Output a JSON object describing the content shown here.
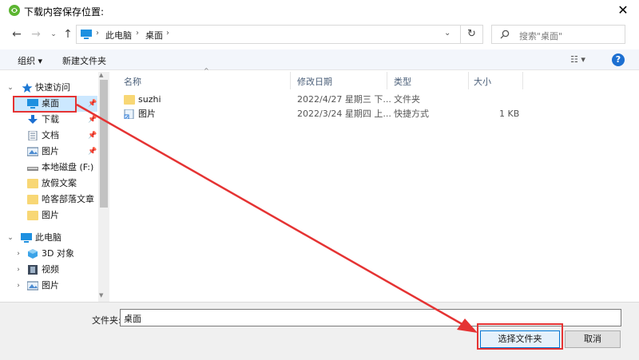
{
  "window": {
    "title": "下载内容保存位置:",
    "close_glyph": "✕"
  },
  "nav": {
    "back": "←",
    "forward": "→",
    "recent": "⌄",
    "up": "↑",
    "breadcrumb": [
      "此电脑",
      "桌面"
    ],
    "separator": "›",
    "dropdown": "⌄",
    "refresh": "↻",
    "search_placeholder": "搜索\"桌面\""
  },
  "toolbar": {
    "organize": "组织 ▾",
    "new_folder": "新建文件夹",
    "view": "☷ ▾",
    "help": "?"
  },
  "sidebar": {
    "items": [
      {
        "label": "快速访问",
        "icon": "star-icon",
        "expand": "⌄"
      },
      {
        "label": "桌面",
        "icon": "desktop-icon",
        "pin": "📌"
      },
      {
        "label": "下载",
        "icon": "download-icon",
        "pin": "📌"
      },
      {
        "label": "文档",
        "icon": "document-icon",
        "pin": "📌"
      },
      {
        "label": "图片",
        "icon": "pictures-icon",
        "pin": "📌"
      },
      {
        "label": "本地磁盘 (F:)",
        "icon": "drive-icon"
      },
      {
        "label": "放假文案",
        "icon": "folder-icon"
      },
      {
        "label": "哈客部落文章",
        "icon": "folder-icon"
      },
      {
        "label": "图片",
        "icon": "folder-icon"
      },
      {
        "label": "此电脑",
        "icon": "computer-icon",
        "expand": "⌄"
      },
      {
        "label": "3D 对象",
        "icon": "3d-objects-icon",
        "expand": "›"
      },
      {
        "label": "视频",
        "icon": "video-icon",
        "expand": "›"
      },
      {
        "label": "图片",
        "icon": "pictures-icon",
        "expand": "›"
      }
    ],
    "scroll_up": "▲",
    "scroll_down": "▼"
  },
  "file_list": {
    "columns": [
      "名称",
      "修改日期",
      "类型",
      "大小"
    ],
    "sort_arrow": "^",
    "rows": [
      {
        "name": "suzhi",
        "date": "2022/4/27 星期三 下...",
        "type": "文件夹",
        "size": "",
        "icon": "folder-icon"
      },
      {
        "name": "图片",
        "date": "2022/3/24 星期四 上...",
        "type": "快捷方式",
        "size": "1 KB",
        "icon": "shortcut-icon"
      }
    ]
  },
  "bottom": {
    "folder_label": "文件夹:",
    "folder_value": "桌面",
    "select_button": "选择文件夹",
    "cancel_button": "取消"
  },
  "colors": {
    "annotation": "#e53333",
    "selection": "#cce8ff",
    "accent": "#0078d7"
  }
}
